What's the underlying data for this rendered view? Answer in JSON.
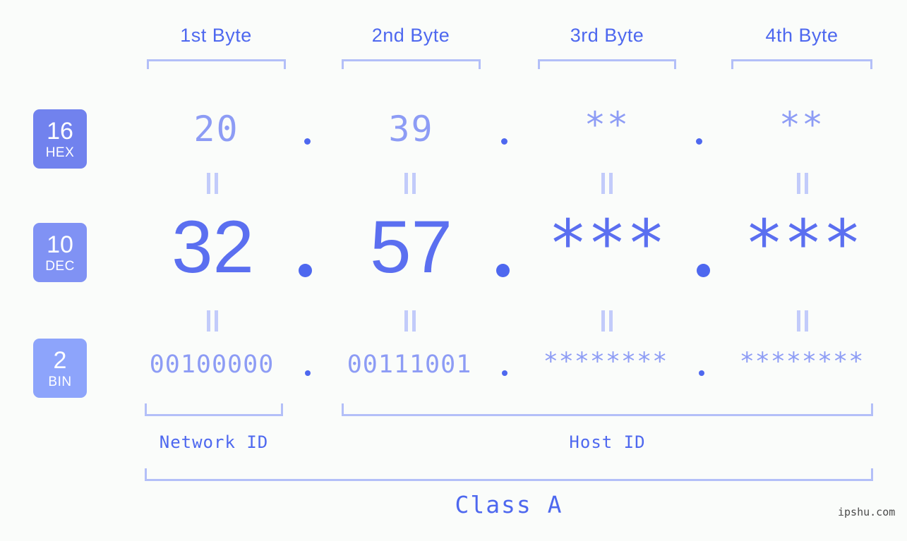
{
  "background_color": "#fafcfa",
  "accent_color": "#4e68ef",
  "muted_accent_color": "#8d9cf5",
  "bracket_color": "#b3bff8",
  "byte_headers": [
    {
      "label": "1st Byte"
    },
    {
      "label": "2nd Byte"
    },
    {
      "label": "3rd Byte"
    },
    {
      "label": "4th Byte"
    }
  ],
  "radix_badges": [
    {
      "num": "16",
      "label": "HEX",
      "color": "#7182ee"
    },
    {
      "num": "10",
      "label": "DEC",
      "color": "#8092f4"
    },
    {
      "num": "2",
      "label": "BIN",
      "color": "#8da4fb"
    }
  ],
  "rows": {
    "hex": {
      "values": [
        "20",
        "39",
        "**",
        "**"
      ],
      "separator": "."
    },
    "dec": {
      "values": [
        "32",
        "57",
        "***",
        "***"
      ],
      "separator": "."
    },
    "bin": {
      "values": [
        "00100000",
        "00111001",
        "********",
        "********"
      ],
      "separator": "."
    }
  },
  "connector": "||",
  "segments": {
    "network_id": "Network ID",
    "host_id": "Host ID"
  },
  "class_label": "Class A",
  "watermark": "ipshu.com"
}
